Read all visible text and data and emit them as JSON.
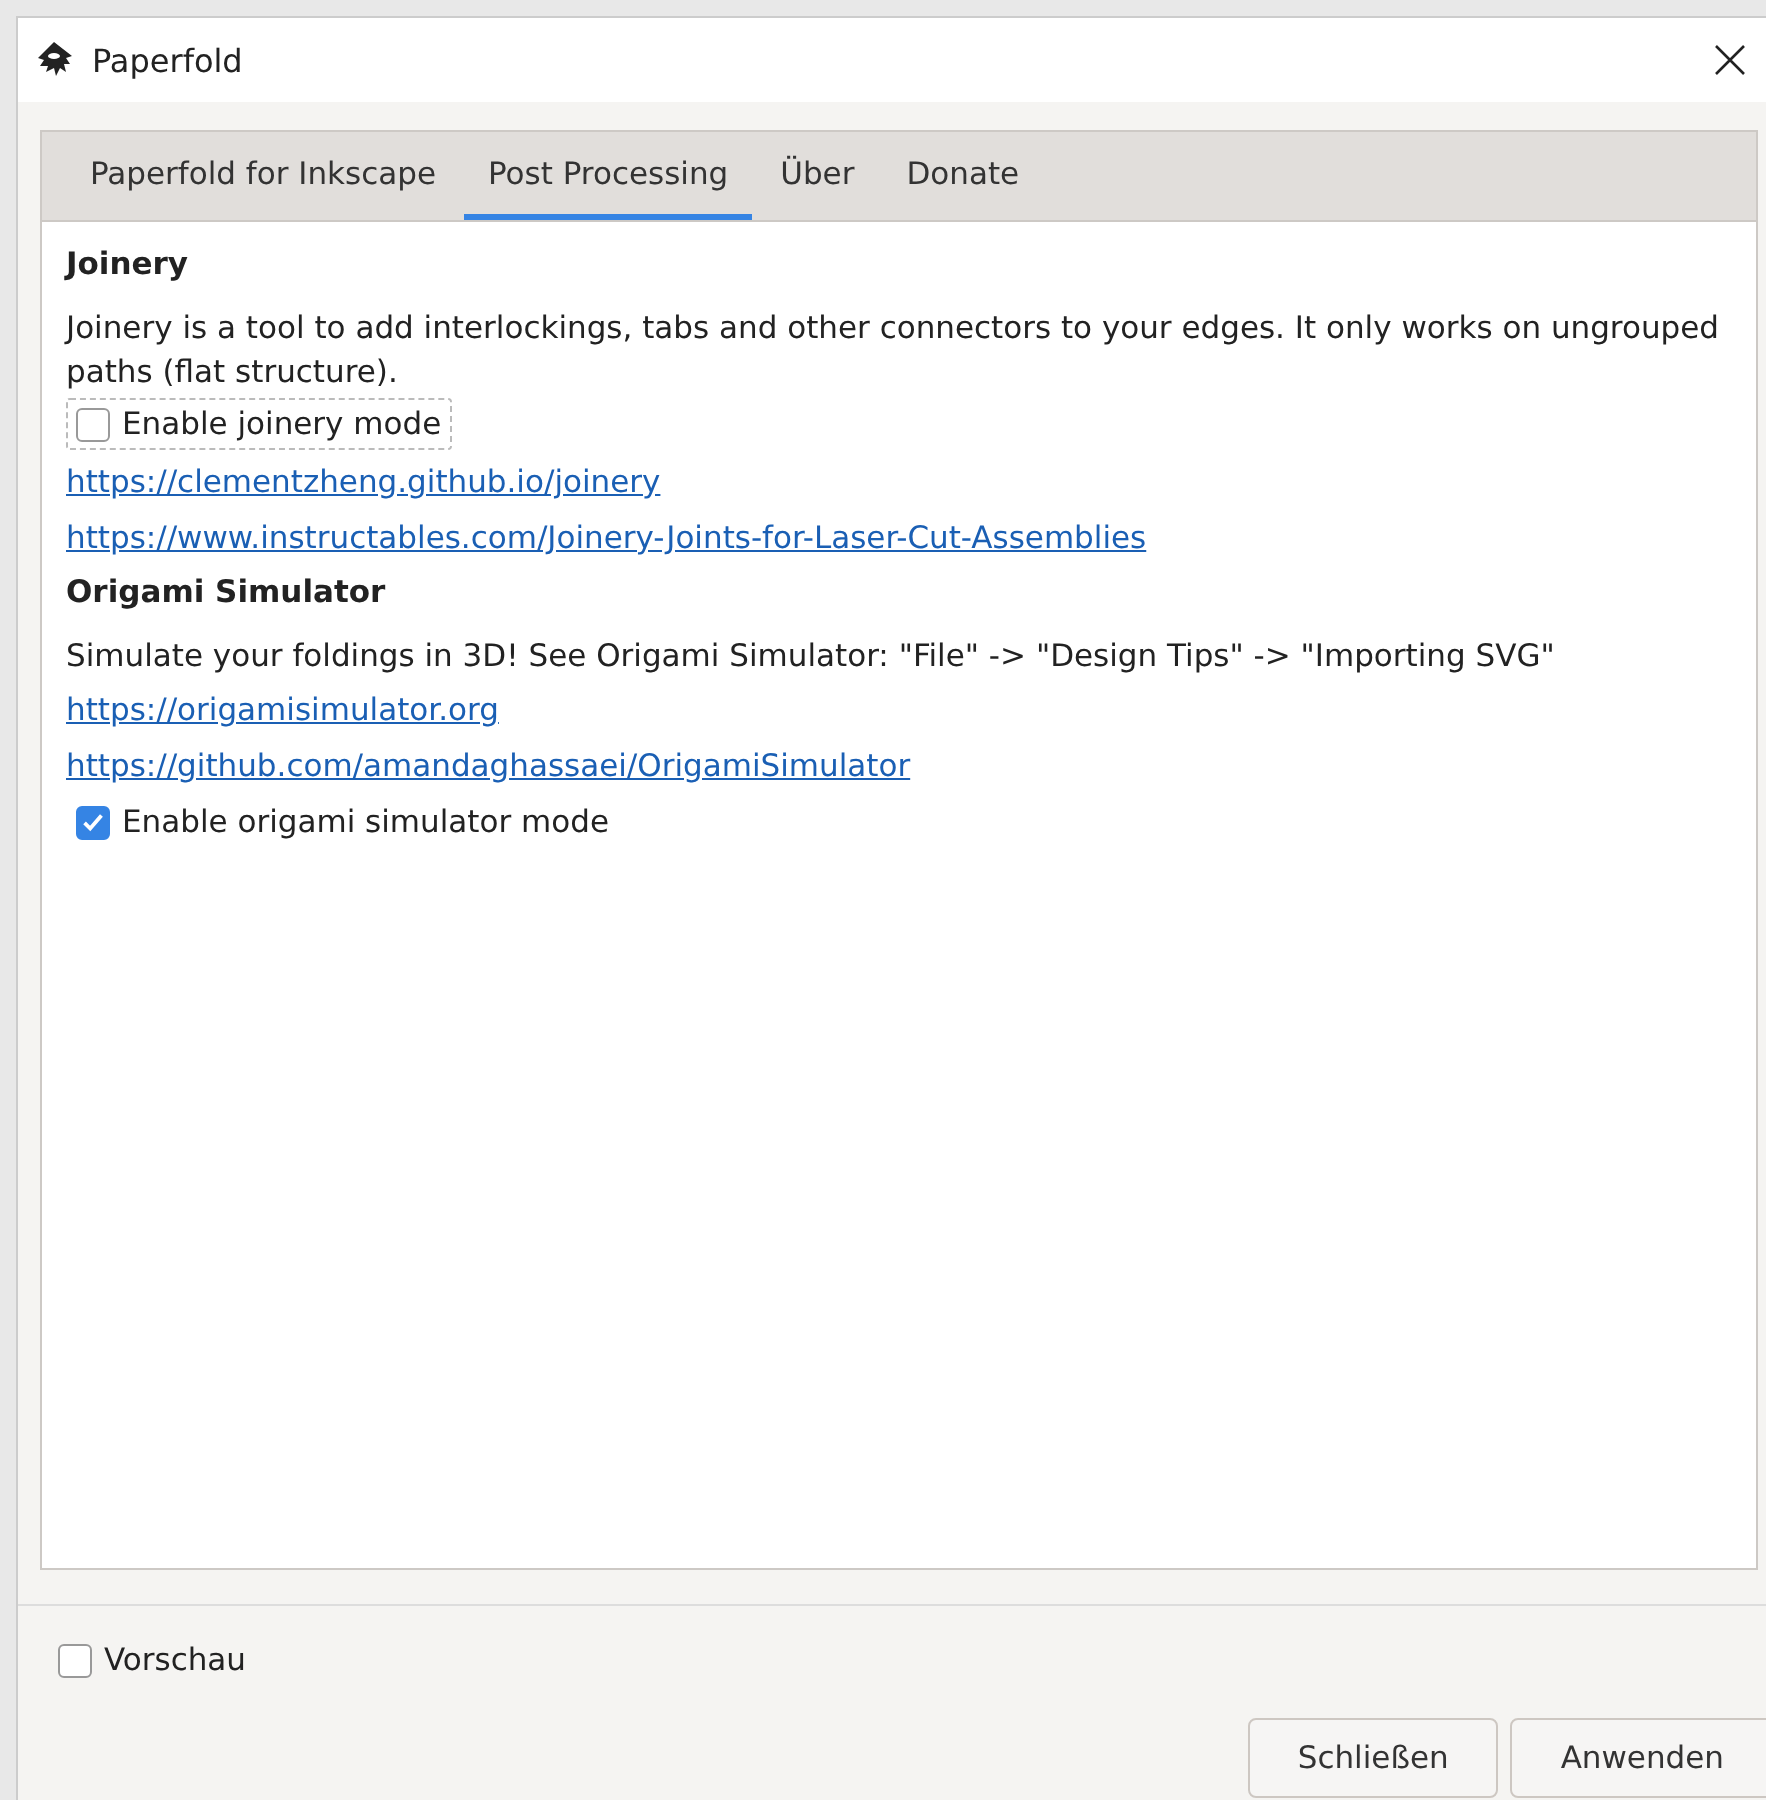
{
  "window": {
    "title": "Paperfold"
  },
  "tabs": [
    {
      "label": "Paperfold for Inkscape",
      "selected": false
    },
    {
      "label": "Post Processing",
      "selected": true
    },
    {
      "label": "Über",
      "selected": false
    },
    {
      "label": "Donate",
      "selected": false
    }
  ],
  "sections": [
    {
      "heading": "Joinery",
      "description": "Joinery is a tool to add interlockings, tabs and other connectors to your edges. It only works on ungrouped paths (flat structure).",
      "items": [
        {
          "kind": "checkbox",
          "label": "Enable joinery mode",
          "checked": false,
          "focused": true
        },
        {
          "kind": "link",
          "label": "https://clementzheng.github.io/joinery"
        },
        {
          "kind": "link",
          "label": "https://www.instructables.com/Joinery-Joints-for-Laser-Cut-Assemblies"
        }
      ]
    },
    {
      "heading": "Origami Simulator",
      "description": "Simulate your foldings in 3D! See Origami Simulator: \"File\" -> \"Design Tips\" -> \"Importing SVG\"",
      "items": [
        {
          "kind": "link",
          "label": "https://origamisimulator.org"
        },
        {
          "kind": "link",
          "label": "https://github.com/amandaghassaei/OrigamiSimulator"
        },
        {
          "kind": "checkbox",
          "label": "Enable origami simulator mode",
          "checked": true,
          "focused": false
        }
      ]
    }
  ],
  "preview": {
    "label": "Vorschau",
    "checked": false
  },
  "buttons": [
    "Schließen",
    "Anwenden"
  ]
}
